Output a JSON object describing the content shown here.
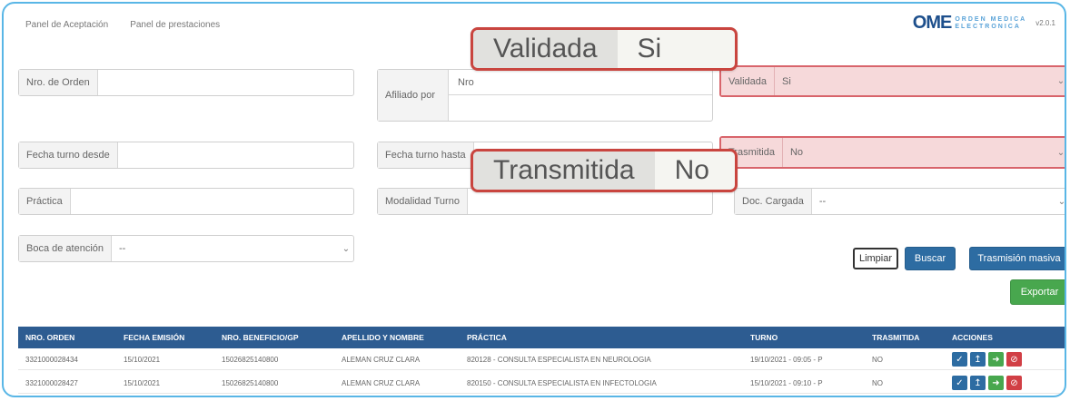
{
  "nav": {
    "tab1": "Panel de Aceptación",
    "tab2": "Panel de prestaciones"
  },
  "brand": {
    "logo": "OME",
    "sub1": "ORDEN MEDICA",
    "sub2": "ELECTRONICA",
    "version": "v2.0.1"
  },
  "filters": {
    "nro_orden": {
      "label": "Nro. de Orden",
      "value": ""
    },
    "afiliado": {
      "label": "Afiliado por",
      "option": "Nro",
      "value": ""
    },
    "validada": {
      "label": "Validada",
      "value": "Si"
    },
    "fecha_desde": {
      "label": "Fecha turno desde",
      "value": ""
    },
    "fecha_hasta": {
      "label": "Fecha turno hasta",
      "value": ""
    },
    "trasmitida": {
      "label": "Trasmitida",
      "value": "No"
    },
    "practica": {
      "label": "Práctica",
      "value": ""
    },
    "modalidad": {
      "label": "Modalidad Turno",
      "value": ""
    },
    "doc_cargada": {
      "label": "Doc. Cargada",
      "value": "--"
    },
    "boca": {
      "label": "Boca de atención",
      "value": "--"
    }
  },
  "callouts": {
    "validada": {
      "label": "Validada",
      "value": "Si"
    },
    "transmitida": {
      "label": "Transmitida",
      "value": "No"
    }
  },
  "buttons": {
    "limpiar": "Limpiar",
    "buscar": "Buscar",
    "masiva": "Trasmisión masiva",
    "exportar": "Exportar"
  },
  "table": {
    "headers": [
      "NRO. ORDEN",
      "FECHA EMISIÓN",
      "NRO. BENEFICIO/GP",
      "APELLIDO Y NOMBRE",
      "PRÁCTICA",
      "TURNO",
      "TRASMITIDA",
      "ACCIONES"
    ],
    "rows": [
      [
        "3321000028434",
        "15/10/2021",
        "15026825140800",
        "ALEMAN CRUZ CLARA",
        "820128 - CONSULTA ESPECIALISTA EN NEUROLOGIA",
        "19/10/2021 - 09:05 - P",
        "NO"
      ],
      [
        "3321000028427",
        "15/10/2021",
        "15026825140800",
        "ALEMAN CRUZ CLARA",
        "820150 - CONSULTA ESPECIALISTA EN INFECTOLOGIA",
        "15/10/2021 - 09:10 - P",
        "NO"
      ]
    ]
  },
  "icons": {
    "validate": "check-icon",
    "upload": "upload-icon",
    "send": "arrow-right-icon",
    "cancel": "cancel-icon"
  }
}
